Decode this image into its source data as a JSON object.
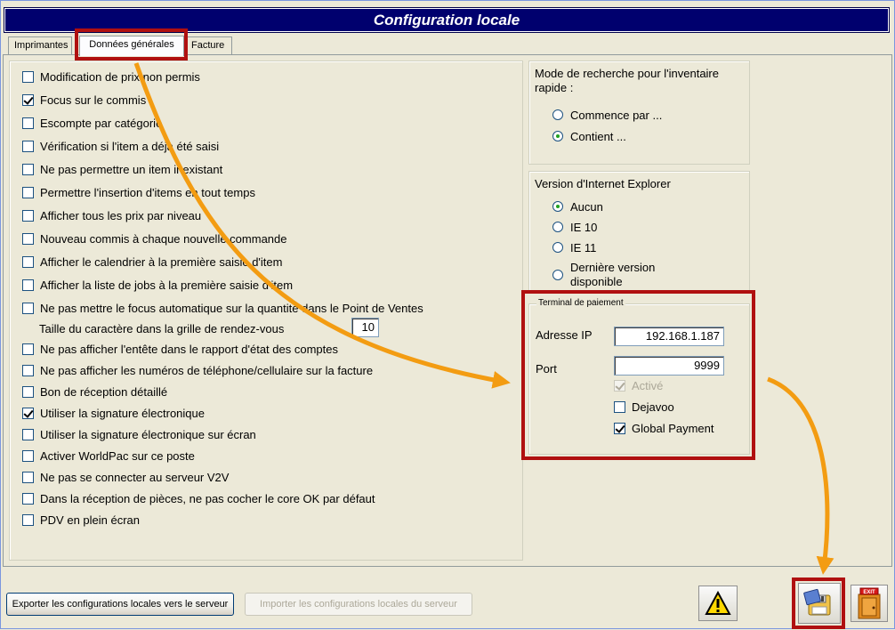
{
  "window": {
    "title": "Configuration locale"
  },
  "tabs": [
    "Imprimantes",
    "Données générales",
    "Facture"
  ],
  "options": [
    {
      "label": "Modification de prix non permis",
      "checked": false
    },
    {
      "label": "Focus sur le commis",
      "checked": true
    },
    {
      "label": "Escompte par catégorie",
      "checked": false
    },
    {
      "label": "Vérification si l'item a déjà été saisi",
      "checked": false
    },
    {
      "label": "Ne pas permettre un item inexistant",
      "checked": false
    },
    {
      "label": "Permettre l'insertion d'items en tout temps",
      "checked": false
    },
    {
      "label": "Afficher tous les prix par niveau",
      "checked": false
    },
    {
      "label": "Nouveau commis à chaque nouvelle commande",
      "checked": false
    },
    {
      "label": "Afficher le calendrier à la première saisie d'item",
      "checked": false
    },
    {
      "label": "Afficher la liste de jobs à la première saisie d'item",
      "checked": false
    },
    {
      "label": "Ne pas mettre le focus automatique sur la quantité dans le Point de Ventes",
      "checked": false
    }
  ],
  "font_size": {
    "label": "Taille du caractère dans la grille de rendez-vous",
    "value": "10"
  },
  "options2": [
    {
      "label": "Ne pas afficher l'entête dans le rapport d'état des comptes",
      "checked": false
    },
    {
      "label": "Ne pas afficher les numéros de téléphone/cellulaire sur la facture",
      "checked": false
    },
    {
      "label": "Bon de réception détaillé",
      "checked": false
    },
    {
      "label": "Utiliser la signature électronique",
      "checked": true
    },
    {
      "label": "Utiliser la signature électronique sur écran",
      "checked": false
    },
    {
      "label": "Activer WorldPac sur ce poste",
      "checked": false
    },
    {
      "label": "Ne pas se connecter au serveur V2V",
      "checked": false
    },
    {
      "label": "Dans la réception de pièces, ne pas cocher le core OK par défaut",
      "checked": false
    },
    {
      "label": "PDV en plein écran",
      "checked": false
    }
  ],
  "search_mode": {
    "title": "Mode de recherche pour l'inventaire rapide :",
    "options": [
      {
        "label": "Commence par ...",
        "selected": false
      },
      {
        "label": "Contient ...",
        "selected": true
      }
    ]
  },
  "ie_version": {
    "title": "Version d'Internet Explorer",
    "options": [
      {
        "label": "Aucun",
        "selected": true
      },
      {
        "label": "IE 10",
        "selected": false
      },
      {
        "label": "IE 11",
        "selected": false
      },
      {
        "label": "Dernière version disponible",
        "selected": false
      }
    ]
  },
  "payment_terminal": {
    "legend": "Terminal de paiement",
    "ip_label": "Adresse IP",
    "ip_value": "192.168.1.187",
    "port_label": "Port",
    "port_value": "9999",
    "active_label": "Activé",
    "active_checked": true,
    "dejavoo_label": "Dejavoo",
    "dejavoo_checked": false,
    "global_label": "Global Payment",
    "global_checked": true
  },
  "footer": {
    "export_label": "Exporter les configurations locales vers le serveur",
    "import_label": "Importer les configurations locales du serveur",
    "exit_icon_text": "EXIT"
  },
  "icons": [
    "warning-icon",
    "save-floppy-icon",
    "exit-door-icon"
  ],
  "colors": {
    "title_bar": "#00006e",
    "highlight": "#b01010",
    "arrow": "#f39c12"
  }
}
